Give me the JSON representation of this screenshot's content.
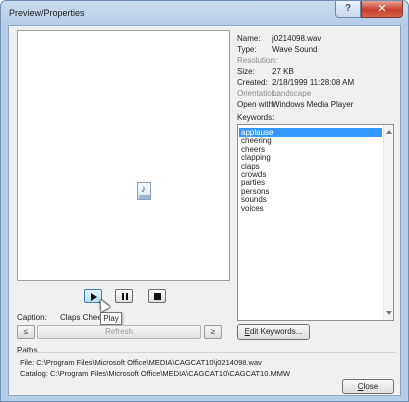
{
  "window": {
    "title": "Preview/Properties",
    "help_glyph": "?",
    "close_glyph": "✕"
  },
  "properties": [
    {
      "label": "Name:",
      "value": "j0214098.wav",
      "dim": false
    },
    {
      "label": "Type:",
      "value": "Wave Sound",
      "dim": false
    },
    {
      "label": "Resolution:",
      "value": "",
      "dim": true
    },
    {
      "label": "Size:",
      "value": "27 KB",
      "dim": false
    },
    {
      "label": "Created:",
      "value": "2/18/1999 11:28:08 AM",
      "dim": false
    },
    {
      "label": "Orientation:",
      "value": "Landscape",
      "dim": true
    },
    {
      "label": "Open with:",
      "value": "Windows Media Player",
      "dim": false
    }
  ],
  "keywords": {
    "label": "Keywords:",
    "items": [
      "applause",
      "cheering",
      "cheers",
      "clapping",
      "claps",
      "crowds",
      "parties",
      "persons",
      "sounds",
      "voices"
    ],
    "selected_index": 0
  },
  "media": {
    "play_tooltip": "Play"
  },
  "caption": {
    "label": "Caption:",
    "value": "Claps Cheers"
  },
  "nav": {
    "prev_glyph": "≤",
    "next_glyph": "≥",
    "refresh_label": "Refresh"
  },
  "edit_keywords": {
    "label_prefix": "E",
    "label_rest": "dit Keywords..."
  },
  "paths": {
    "heading": "Paths",
    "file": "File: C:\\Program Files\\Microsoft Office\\MEDIA\\CAGCAT10\\j0214098.wav",
    "catalog": "Catalog: C:\\Program Files\\Microsoft Office\\MEDIA\\CAGCAT10\\CAGCAT10.MMW"
  },
  "close_button": {
    "label_prefix": "C",
    "label_rest": "lose"
  }
}
